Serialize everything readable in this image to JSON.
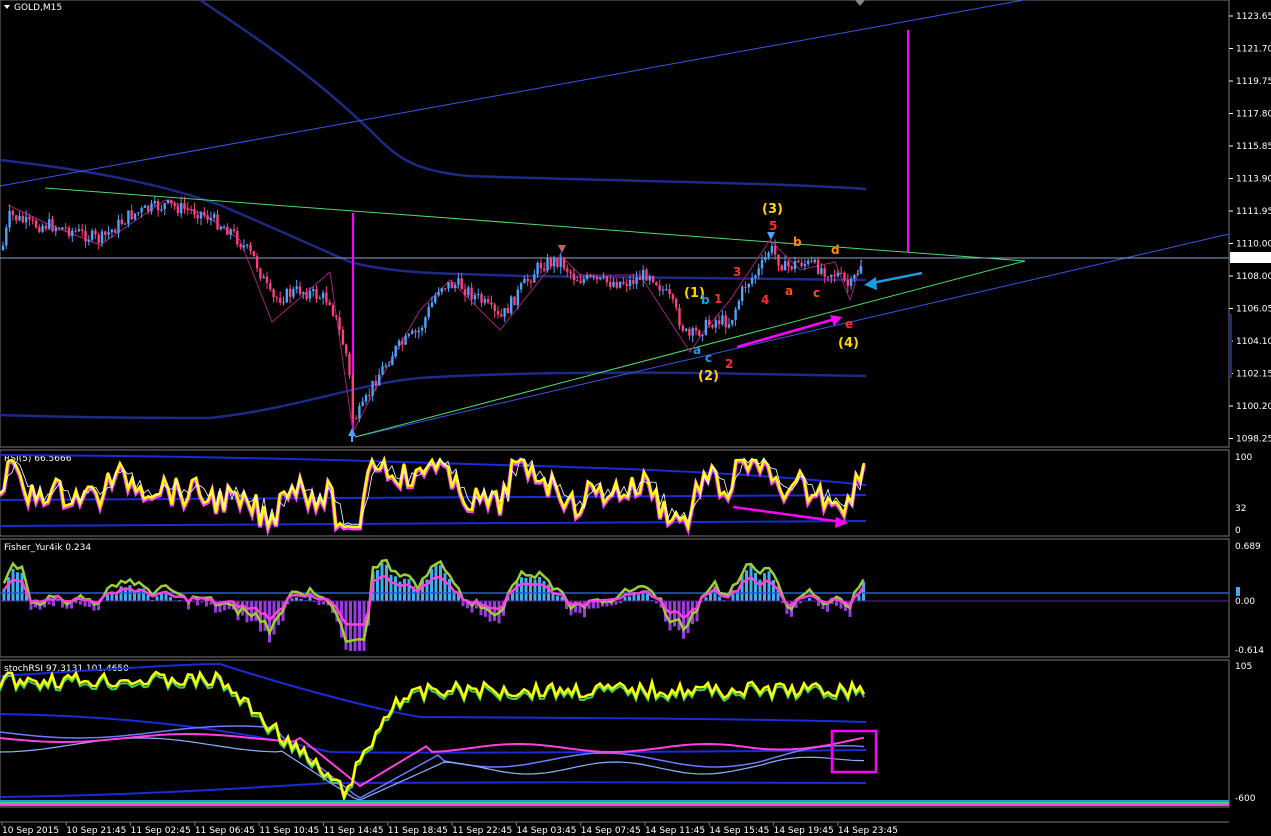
{
  "window": {
    "symbol_title": "GOLD,M15"
  },
  "price_axis": {
    "ticks": [
      "1123.65",
      "1121.70",
      "1119.75",
      "1117.80",
      "1115.85",
      "1113.90",
      "1111.95",
      "1110.00",
      "1108.00",
      "1106.05",
      "1104.10",
      "1102.15",
      "1100.20",
      "1098.25"
    ],
    "current": "1109.21",
    "colors": {
      "bull": "#4aa3ff",
      "bear": "#ff3d7f",
      "grid": "#ffffff",
      "current_line": "#87a7c7"
    }
  },
  "time_axis": {
    "ticks": [
      "10 Sep 2015",
      "10 Sep 21:45",
      "11 Sep 02:45",
      "11 Sep 06:45",
      "11 Sep 10:45",
      "11 Sep 14:45",
      "11 Sep 18:45",
      "11 Sep 22:45",
      "14 Sep 03:45",
      "14 Sep 07:45",
      "14 Sep 11:45",
      "14 Sep 15:45",
      "14 Sep 19:45",
      "14 Sep 23:45"
    ]
  },
  "waves": {
    "w1": "(1)",
    "w2": "(2)",
    "w3": "(3)",
    "w4": "(4)",
    "s1": "1",
    "s2": "2",
    "s3": "3",
    "s4": "4",
    "s5": "5",
    "a1": "a",
    "b1": "b",
    "c1": "c",
    "a2": "a",
    "b2": "b",
    "c2": "c",
    "d2": "d",
    "e2": "e"
  },
  "rsi": {
    "title": "RSI(5) 66.5666",
    "ticks": [
      "100",
      "32",
      "0"
    ]
  },
  "fisher": {
    "title": "Fisher_Yur4ik 0.234",
    "ticks": [
      "0.689",
      "0.00",
      "-0.614"
    ]
  },
  "stoch": {
    "title": "stochRSI 97.3131 101.4650",
    "ticks": [
      "105",
      "-600"
    ]
  }
}
